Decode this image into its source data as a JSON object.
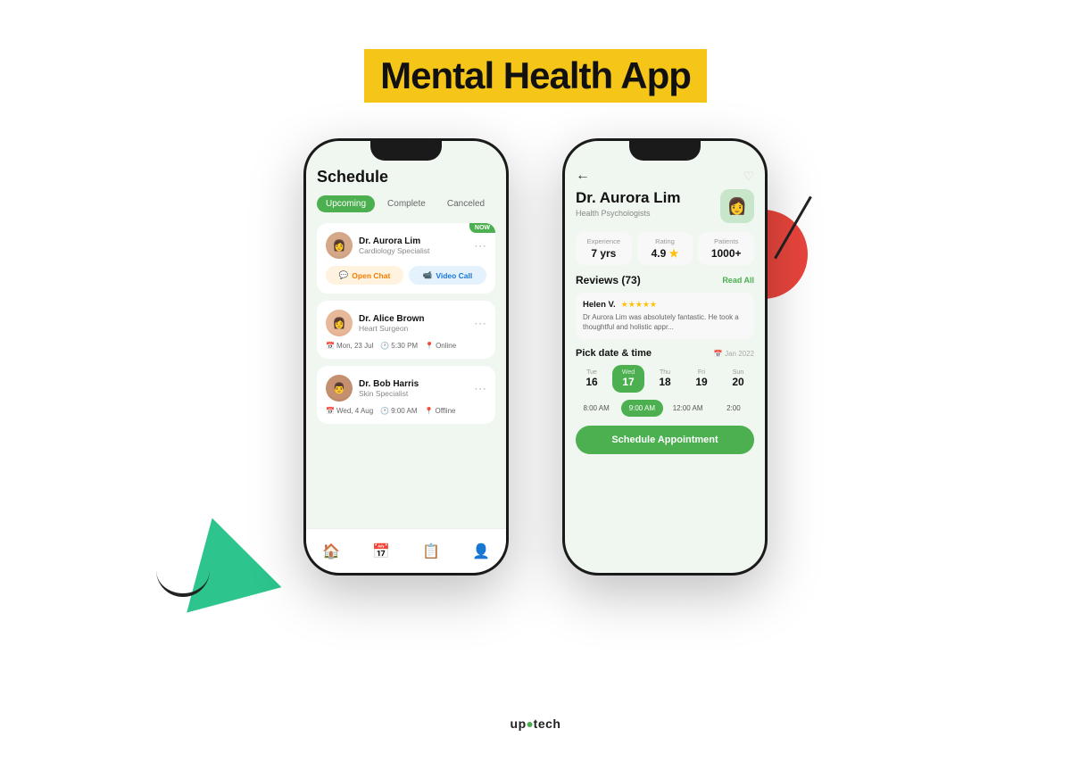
{
  "page": {
    "title": "Mental Health App",
    "background": "#ffffff"
  },
  "phone1": {
    "screen_title": "Schedule",
    "tabs": [
      "Upcoming",
      "Complete",
      "Canceled"
    ],
    "active_tab": "Upcoming",
    "appointments": [
      {
        "doctor": "Dr. Aurora Lim",
        "specialty": "Cardiology Specialist",
        "badge": "NOW",
        "actions": [
          "Open Chat",
          "Video Call"
        ]
      },
      {
        "doctor": "Dr. Alice Brown",
        "specialty": "Heart Surgeon",
        "date": "Mon, 23 Jul",
        "time": "5:30 PM",
        "mode": "Online"
      },
      {
        "doctor": "Dr. Bob Harris",
        "specialty": "Skin Specialist",
        "date": "Wed, 4 Aug",
        "time": "9:00 AM",
        "mode": "Offline"
      }
    ],
    "nav_items": [
      "home",
      "calendar",
      "list",
      "person"
    ]
  },
  "phone2": {
    "doctor_name": "Dr. Aurora Lim",
    "doctor_title": "Health Psychologists",
    "stats": {
      "experience_label": "Experience",
      "experience_value": "7 yrs",
      "rating_label": "Rating",
      "rating_value": "4.9",
      "patients_label": "Patients",
      "patients_value": "1000+"
    },
    "reviews_title": "Reviews (73)",
    "read_all": "Read All",
    "review": {
      "name": "Helen V.",
      "stars": 5,
      "text": "Dr Aurora Lim was absolutely fantastic. He took a thoughtful and holistic appr..."
    },
    "pick_date_title": "Pick date & time",
    "date_month": "Jan 2022",
    "dates": [
      {
        "day": "Tue",
        "num": "16"
      },
      {
        "day": "Wed",
        "num": "17",
        "selected": true
      },
      {
        "day": "Thu",
        "num": "18"
      },
      {
        "day": "Fri",
        "num": "19"
      },
      {
        "day": "Sun",
        "num": "20"
      }
    ],
    "times": [
      {
        "time": "8:00 AM"
      },
      {
        "time": "9:00 AM",
        "selected": true
      },
      {
        "time": "12:00 AM"
      },
      {
        "time": "2:00"
      }
    ],
    "schedule_button": "Schedule Appointment"
  },
  "footer": {
    "logo": "up tech"
  }
}
